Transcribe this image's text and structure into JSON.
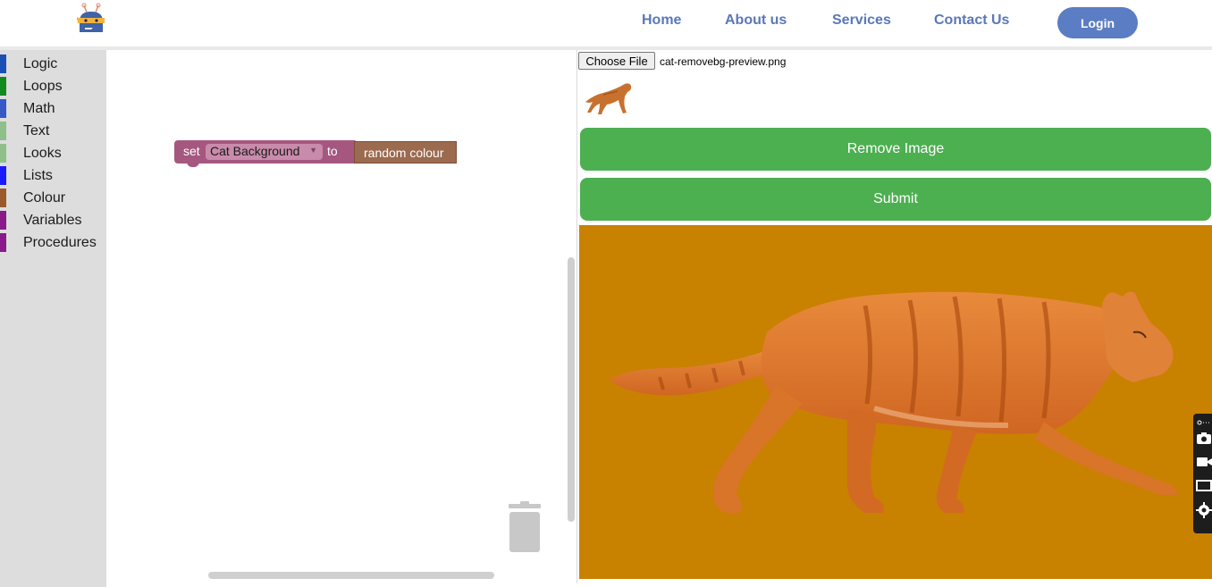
{
  "nav": {
    "links": [
      "Home",
      "About us",
      "Services",
      "Contact Us"
    ],
    "login": "Login"
  },
  "toolbox": {
    "categories": [
      {
        "label": "Logic",
        "color": "#1a4fb5"
      },
      {
        "label": "Loops",
        "color": "#138a1d"
      },
      {
        "label": "Math",
        "color": "#3559c7"
      },
      {
        "label": "Text",
        "color": "#8fc08a"
      },
      {
        "label": "Looks",
        "color": "#8fc08a"
      },
      {
        "label": "Lists",
        "color": "#1a1aff"
      },
      {
        "label": "Colour",
        "color": "#9b5a2b"
      },
      {
        "label": "Variables",
        "color": "#8a1a8a"
      },
      {
        "label": "Procedures",
        "color": "#8a1a8a"
      }
    ]
  },
  "workspace": {
    "block": {
      "set": "set",
      "variable": "Cat Background",
      "to": "to",
      "value": "random colour"
    }
  },
  "upload": {
    "choose_file": "Choose File",
    "file_name": "cat-removebg-preview.png"
  },
  "buttons": {
    "remove": "Remove Image",
    "submit": "Submit"
  },
  "preview": {
    "background": "#c98100"
  },
  "colors": {
    "accent": "#5b7dc4",
    "button_green": "#4caf50",
    "block_set": "#a5577f",
    "block_colour": "#9b6a4f"
  }
}
